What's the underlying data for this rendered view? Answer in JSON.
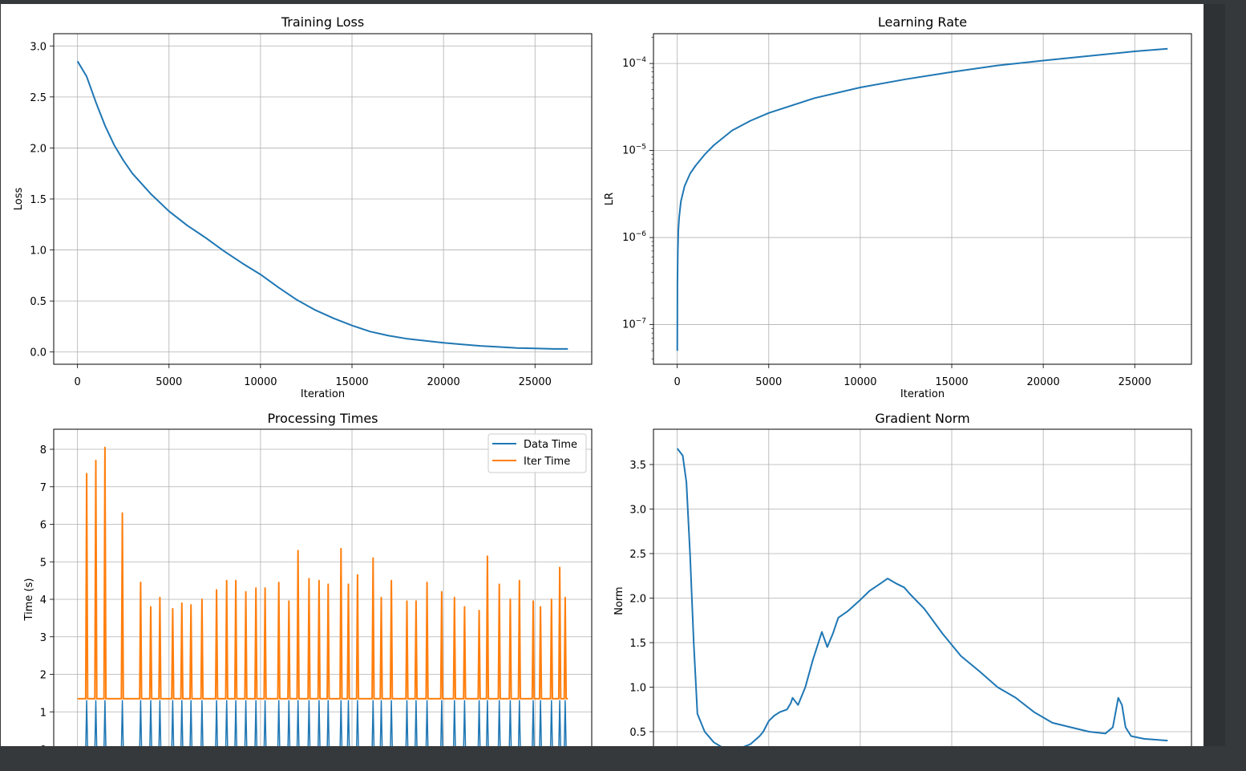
{
  "chart_data": [
    {
      "type": "line",
      "title": "Training Loss",
      "xlabel": "Iteration",
      "ylabel": "Loss",
      "xlim": [
        -1300,
        28100
      ],
      "ylim": [
        -0.12,
        3.12
      ],
      "xticks": [
        0,
        5000,
        10000,
        15000,
        20000,
        25000
      ],
      "xtick_labels": [
        "0",
        "5000",
        "10000",
        "15000",
        "20000",
        "25000"
      ],
      "yticks": [
        0.0,
        0.5,
        1.0,
        1.5,
        2.0,
        2.5,
        3.0
      ],
      "ytick_labels": [
        "0.0",
        "0.5",
        "1.0",
        "1.5",
        "2.0",
        "2.5",
        "3.0"
      ],
      "grid": true,
      "series": [
        {
          "color": "#1f77b4",
          "x": [
            0,
            500,
            1000,
            1500,
            2000,
            2500,
            3000,
            4000,
            5000,
            6000,
            7000,
            8000,
            9000,
            10000,
            11000,
            12000,
            13000,
            14000,
            15000,
            16000,
            17000,
            18000,
            19000,
            20000,
            21000,
            22000,
            23000,
            24000,
            25000,
            26000,
            26800
          ],
          "values": [
            2.85,
            2.7,
            2.45,
            2.22,
            2.03,
            1.88,
            1.75,
            1.55,
            1.38,
            1.24,
            1.12,
            0.99,
            0.87,
            0.76,
            0.63,
            0.51,
            0.41,
            0.33,
            0.26,
            0.2,
            0.16,
            0.13,
            0.11,
            0.09,
            0.075,
            0.06,
            0.05,
            0.04,
            0.035,
            0.03,
            0.03
          ]
        }
      ]
    },
    {
      "type": "line",
      "title": "Learning Rate",
      "xlabel": "Iteration",
      "ylabel": "LR",
      "xscale": "linear",
      "yscale": "log",
      "xlim": [
        -1300,
        28100
      ],
      "ylim": [
        3.5e-08,
        0.00022
      ],
      "xticks": [
        0,
        5000,
        10000,
        15000,
        20000,
        25000
      ],
      "xtick_labels": [
        "0",
        "5000",
        "10000",
        "15000",
        "20000",
        "25000"
      ],
      "ytick_exponents": [
        -7,
        -6,
        -5,
        -4
      ],
      "ytick_base": "10",
      "grid": true,
      "series": [
        {
          "color": "#1f77b4",
          "x": [
            0,
            10,
            30,
            60,
            100,
            200,
            400,
            700,
            1000,
            1500,
            2000,
            3000,
            4000,
            5000,
            7500,
            10000,
            12500,
            15000,
            17500,
            20000,
            22500,
            25000,
            26800
          ],
          "values": [
            5e-08,
            3e-07,
            7e-07,
            1.2e-06,
            1.7e-06,
            2.6e-06,
            3.9e-06,
            5.4e-06,
            6.7e-06,
            9e-06,
            1.15e-05,
            1.7e-05,
            2.2e-05,
            2.7e-05,
            4e-05,
            5.3e-05,
            6.6e-05,
            8e-05,
            9.5e-05,
            0.000108,
            0.000122,
            0.000138,
            0.000148
          ]
        }
      ]
    },
    {
      "type": "line",
      "title": "Processing Times",
      "xlabel": "",
      "ylabel": "Time (s)",
      "xlim": [
        -1300,
        28100
      ],
      "ylim": [
        -0.4,
        8.4
      ],
      "xticks": [
        0,
        5000,
        10000,
        15000,
        20000,
        25000
      ],
      "yticks": [
        0,
        1,
        2,
        3,
        4,
        5,
        6,
        7,
        8
      ],
      "ytick_labels": [
        "0",
        "1",
        "2",
        "3",
        "4",
        "5",
        "6",
        "7",
        "8"
      ],
      "grid": true,
      "legend": "top-right",
      "baseline": {
        "Data Time": 0.0,
        "Iter Time": 1.35
      },
      "spike_x": [
        500,
        1000,
        1500,
        2450,
        3450,
        4000,
        4500,
        5200,
        5700,
        6200,
        6800,
        7600,
        8150,
        8650,
        9200,
        9750,
        10250,
        11000,
        11550,
        12050,
        12650,
        13200,
        13700,
        14400,
        14800,
        15300,
        16150,
        16600,
        17150,
        18000,
        18500,
        19100,
        19900,
        20600,
        21150,
        21950,
        22400,
        23050,
        23650,
        24150,
        24900,
        25300,
        25900,
        26350,
        26650
      ],
      "series": [
        {
          "name": "Data Time",
          "color": "#1f77b4",
          "spike_values": [
            1.3,
            1.3,
            1.3,
            1.3,
            1.3,
            1.3,
            1.3,
            1.3,
            1.3,
            1.3,
            1.3,
            1.3,
            1.3,
            1.3,
            1.3,
            1.3,
            1.3,
            1.3,
            1.3,
            1.3,
            1.3,
            1.3,
            1.3,
            1.3,
            1.3,
            1.3,
            1.3,
            1.3,
            1.3,
            1.3,
            1.3,
            1.3,
            1.3,
            1.3,
            1.3,
            1.3,
            1.3,
            1.3,
            1.3,
            1.3,
            1.3,
            1.3,
            1.3,
            1.3,
            1.3
          ]
        },
        {
          "name": "Iter Time",
          "color": "#ff7f0e",
          "spike_values": [
            7.35,
            7.7,
            8.05,
            6.3,
            4.45,
            3.8,
            4.05,
            3.75,
            3.9,
            3.85,
            4.0,
            4.25,
            4.5,
            4.5,
            4.2,
            4.3,
            4.3,
            4.45,
            3.95,
            5.3,
            4.55,
            4.5,
            4.4,
            5.35,
            4.4,
            4.65,
            5.1,
            4.05,
            4.5,
            3.95,
            3.95,
            4.45,
            4.2,
            4.05,
            3.8,
            3.7,
            5.15,
            4.4,
            4.0,
            4.5,
            3.95,
            3.8,
            4.0,
            4.85,
            4.05
          ]
        }
      ]
    },
    {
      "type": "line",
      "title": "Gradient Norm",
      "xlabel": "",
      "ylabel": "Norm",
      "xlim": [
        -1300,
        28100
      ],
      "ylim": [
        0.13,
        3.83
      ],
      "xticks": [
        0,
        5000,
        10000,
        15000,
        20000,
        25000
      ],
      "yticks": [
        0.5,
        1.0,
        1.5,
        2.0,
        2.5,
        3.0,
        3.5
      ],
      "ytick_labels": [
        "0.5",
        "1.0",
        "1.5",
        "2.0",
        "2.5",
        "3.0",
        "3.5"
      ],
      "grid": true,
      "series": [
        {
          "color": "#1f77b4",
          "x": [
            0,
            300,
            500,
            700,
            900,
            1100,
            1500,
            2000,
            2500,
            3000,
            3500,
            4000,
            4500,
            4700,
            5000,
            5300,
            5600,
            6000,
            6200,
            6300,
            6600,
            7000,
            7400,
            7900,
            8200,
            8500,
            8800,
            9300,
            10000,
            10500,
            11000,
            11500,
            12000,
            12400,
            12700,
            13500,
            14500,
            15500,
            16500,
            17500,
            18500,
            19500,
            20500,
            21500,
            22500,
            23400,
            23800,
            24100,
            24300,
            24500,
            24800,
            25500,
            26800
          ],
          "values": [
            3.68,
            3.6,
            3.3,
            2.5,
            1.5,
            0.7,
            0.5,
            0.38,
            0.32,
            0.3,
            0.32,
            0.36,
            0.45,
            0.5,
            0.62,
            0.68,
            0.72,
            0.75,
            0.82,
            0.88,
            0.8,
            1.0,
            1.3,
            1.62,
            1.45,
            1.6,
            1.78,
            1.85,
            1.98,
            2.08,
            2.15,
            2.22,
            2.16,
            2.12,
            2.05,
            1.88,
            1.6,
            1.35,
            1.18,
            1.0,
            0.88,
            0.72,
            0.6,
            0.55,
            0.5,
            0.48,
            0.55,
            0.88,
            0.8,
            0.55,
            0.45,
            0.42,
            0.4
          ]
        }
      ]
    }
  ]
}
